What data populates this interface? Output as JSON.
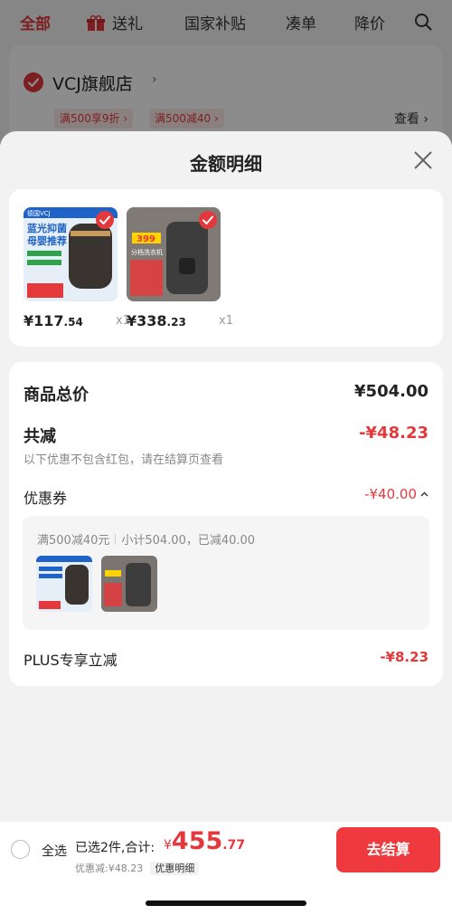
{
  "top_nav": {
    "tabs": [
      "全部",
      "送礼",
      "国家补贴",
      "凑单",
      "降价"
    ]
  },
  "store": {
    "name": "VCJ旗舰店",
    "promos": [
      "满500享9折 ›",
      "满500减40 ›"
    ],
    "view_label": "查看 ›"
  },
  "sheet": {
    "title": "金额明细",
    "products": [
      {
        "price_int": "¥117",
        "price_dec": ".54",
        "qty": "x1",
        "image_text": [
          "德国VCJ",
          "蓝光抑菌",
          "母婴推荐"
        ]
      },
      {
        "price_int": "¥338",
        "price_dec": ".23",
        "qty": "x1",
        "image_text": [
          "399",
          "分档洗衣机"
        ]
      }
    ],
    "detail": {
      "goods_total_label": "商品总价",
      "goods_total_value": "¥504.00",
      "total_discount_label": "共减",
      "total_discount_value": "-¥48.23",
      "note": "以下优惠不包含红包，请在结算页查看",
      "coupon_label": "优惠券",
      "coupon_value": "-¥40.00",
      "coupon_rule": "满500减40元",
      "coupon_subtotal": "小计504.00，已减40.00",
      "plus_label": "PLUS专享立减",
      "plus_value": "-¥8.23"
    }
  },
  "bottom_bar": {
    "select_all": "全选",
    "summary": "已选2件,合计:",
    "total_currency": "¥",
    "total_int": "455",
    "total_dec": ".77",
    "discount_text": "优惠减:¥48.23",
    "detail_chip": "优惠明细",
    "checkout": "去结算"
  },
  "colors": {
    "accent": "#e4393c",
    "checkout_bg": "#ee3a3e",
    "sheet_bg": "#f2f2f2"
  }
}
